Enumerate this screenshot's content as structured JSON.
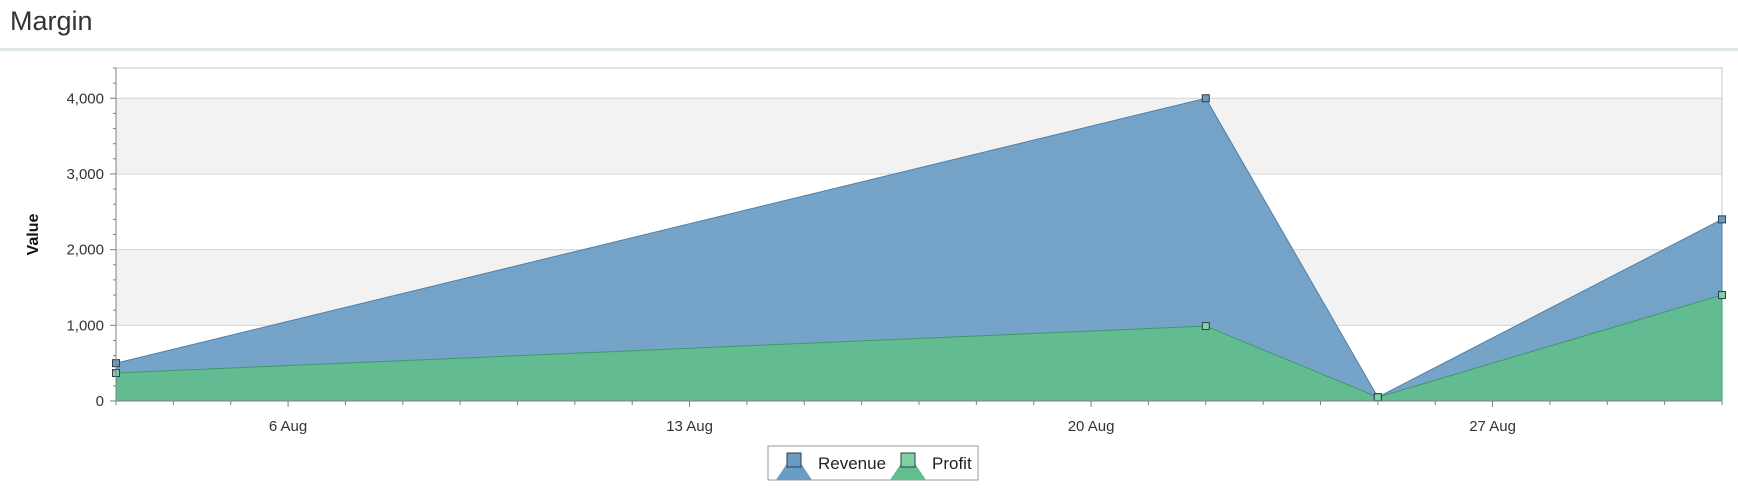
{
  "header": {
    "title": "Margin"
  },
  "chart_data": {
    "type": "area",
    "title": "",
    "xlabel": "",
    "ylabel": "Value",
    "x": [
      "3 Aug",
      "22 Aug",
      "25 Aug",
      "31 Aug"
    ],
    "x_ticks": [
      "6 Aug",
      "13 Aug",
      "20 Aug",
      "27 Aug"
    ],
    "ylim": [
      0,
      4400
    ],
    "y_ticks": [
      "0",
      "1,000",
      "2,000",
      "3,000",
      "4,000"
    ],
    "series": [
      {
        "name": "Revenue",
        "values": [
          500,
          4000,
          50,
          2400
        ],
        "color": "#6a9cc4"
      },
      {
        "name": "Profit",
        "values": [
          370,
          990,
          50,
          1400
        ],
        "color": "#62be8c"
      }
    ],
    "grid": true,
    "alternating_bands": true,
    "legend": "bottom-center"
  }
}
